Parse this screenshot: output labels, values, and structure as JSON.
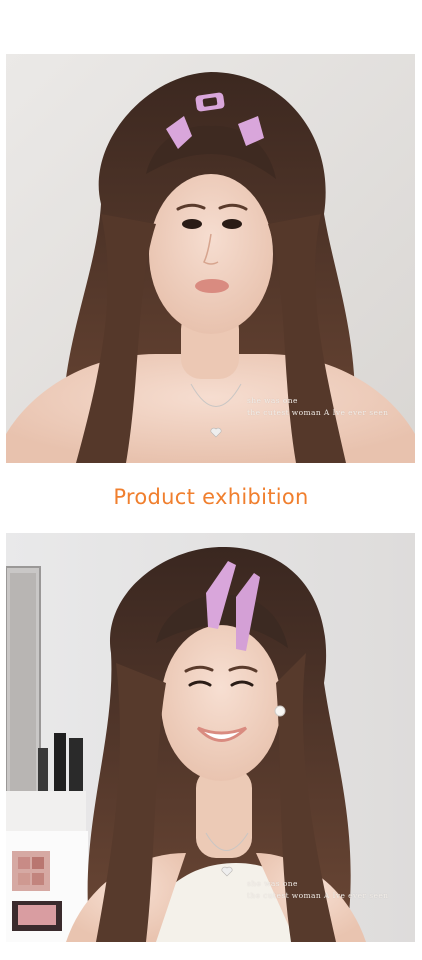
{
  "section_title": "Product exhibition",
  "photos": [
    {
      "caption_line1": "she was one",
      "caption_line2": "the cutest woman A Ive ever seen"
    },
    {
      "caption_line1": "she was one",
      "caption_line2": "the cutest woman A Ive ever seen"
    }
  ],
  "colors": {
    "title": "#f07f2e",
    "clip": "#d9a6db",
    "hair": "#4a3226",
    "background_wall": "#e6e4e2"
  }
}
